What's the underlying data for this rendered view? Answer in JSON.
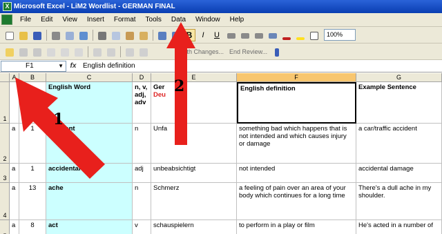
{
  "window": {
    "title": "Microsoft Excel - LiM2 Wordlist - GERMAN FINAL"
  },
  "menu": [
    "File",
    "Edit",
    "View",
    "Insert",
    "Format",
    "Tools",
    "Data",
    "Window",
    "Help"
  ],
  "toolbar2": {
    "review_text": "with Changes...",
    "end_review": "End Review..."
  },
  "toolbar1": {
    "zoom": "100%",
    "bold": "B",
    "italic": "I",
    "underline": "U"
  },
  "formula_bar": {
    "cell_ref": "F1",
    "fx_label": "fx",
    "content": "English definition"
  },
  "columns": [
    "A",
    "B",
    "C",
    "D",
    "E",
    "F",
    "G"
  ],
  "rows": [
    {
      "num": "1",
      "cells": [
        "",
        "",
        "English Word",
        "n, v, adj, adv",
        "Ger",
        "English definition",
        "Example Sentence"
      ],
      "extra": "Deu"
    },
    {
      "num": "2",
      "cells": [
        "a",
        "1",
        "accident",
        "n",
        "Unfa",
        "something bad which happens that is not intended and which causes injury or damage",
        "a car/traffic accident"
      ]
    },
    {
      "num": "3",
      "cells": [
        "a",
        "1",
        "accidental",
        "adj",
        "unbeabsichtigt",
        "not intended",
        "accidental damage"
      ]
    },
    {
      "num": "4",
      "cells": [
        "a",
        "13",
        "ache",
        "n",
        "Schmerz",
        "a feeling of pain over an area of your body which continues for a long time",
        "There's a dull ache in my shoulder."
      ]
    },
    {
      "num": "5",
      "cells": [
        "a",
        "8",
        "act",
        "v",
        "schauspielern",
        "to perform in a play or film",
        "He's acted in a number of"
      ]
    }
  ],
  "annotations": {
    "arrow1": "1",
    "arrow2": "2"
  },
  "colors": {
    "arrow": "#e8201c",
    "title_bar": "#0a3eb2",
    "selected_header": "#f8c66f",
    "cyan_column": "#ccffff"
  }
}
